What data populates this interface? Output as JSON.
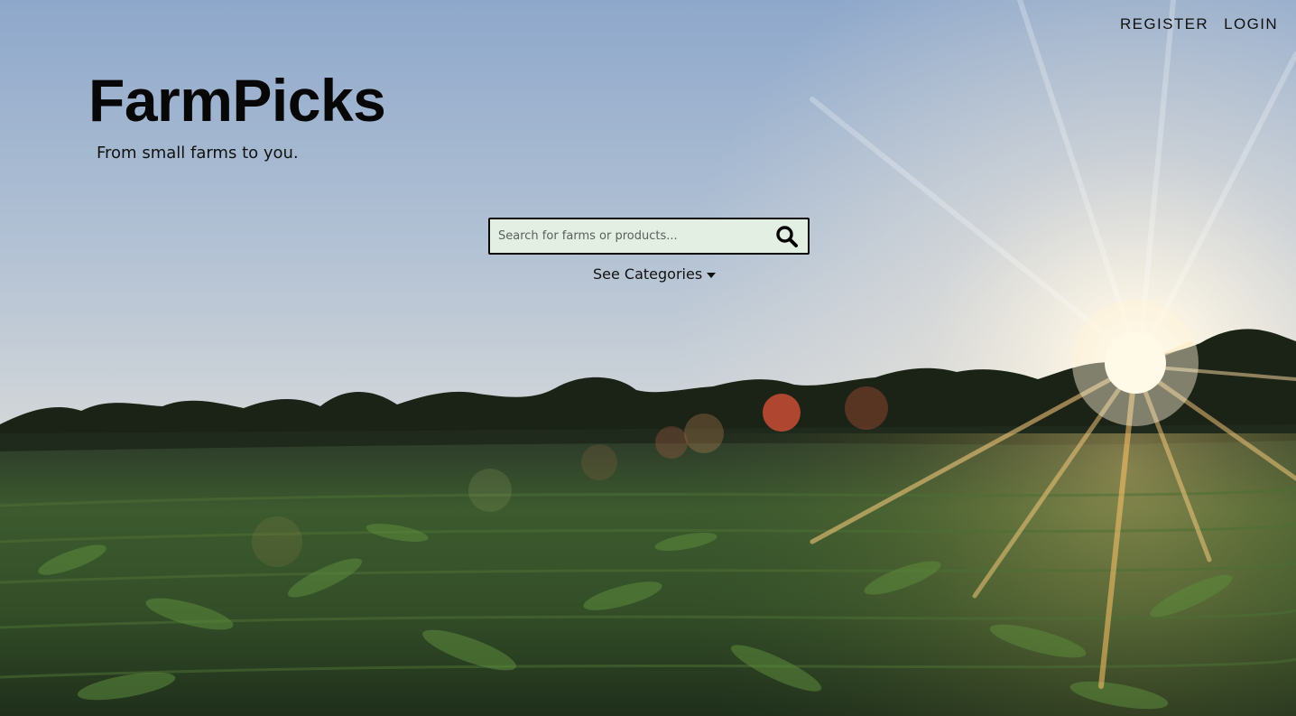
{
  "nav": {
    "register": "REGISTER",
    "login": "LOGIN"
  },
  "brand": {
    "title": "FarmPicks",
    "tagline": "From small farms to you."
  },
  "search": {
    "placeholder": "Search for farms or products...",
    "value": "",
    "icon": "search-icon"
  },
  "categories": {
    "label": "See Categories",
    "icon": "caret-down-icon"
  },
  "background": {
    "subject": "cornfield at sunset",
    "sky_top": "#8fa9cc",
    "sky_mid": "#c9d3dc",
    "horizon_glow": "#f2e7d2",
    "field": "#2f4a24",
    "sun": "#fff7e0"
  }
}
